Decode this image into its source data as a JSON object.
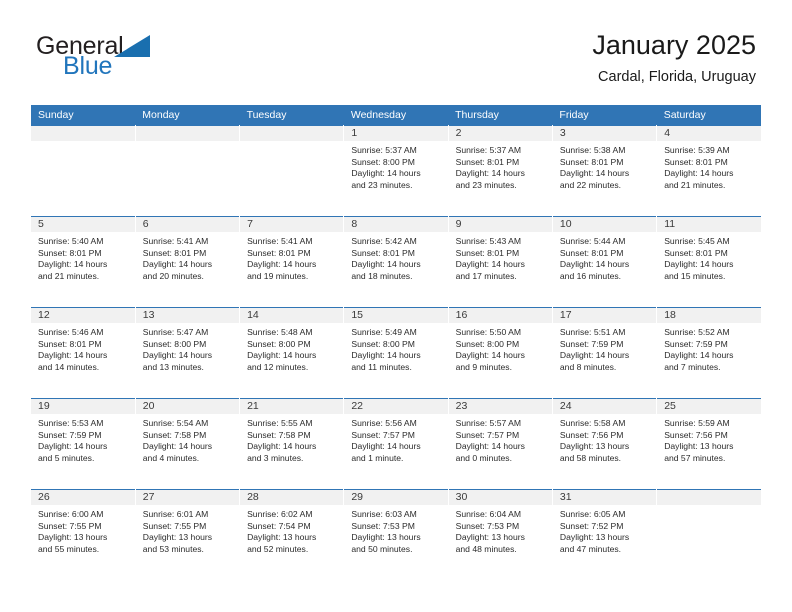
{
  "brand": {
    "name_part1": "General",
    "name_part2": "Blue",
    "triangle_icon": "blue-triangle-logo-mark",
    "accent_color": "#2175bc"
  },
  "header": {
    "title": "January 2025",
    "subtitle": "Cardal, Florida, Uruguay"
  },
  "colors": {
    "header_row_background": "#3075b5",
    "header_row_text": "#ffffff",
    "daynumber_band_background": "#f1f1f1",
    "cell_border": "#3075b5",
    "body_text": "#2b2b2b"
  },
  "weekdays": [
    "Sunday",
    "Monday",
    "Tuesday",
    "Wednesday",
    "Thursday",
    "Friday",
    "Saturday"
  ],
  "labels": {
    "sunrise_prefix": "Sunrise:",
    "sunset_prefix": "Sunset:",
    "daylight_prefix": "Daylight:"
  },
  "weeks": [
    [
      {
        "blank": true,
        "day": ""
      },
      {
        "blank": true,
        "day": ""
      },
      {
        "blank": true,
        "day": ""
      },
      {
        "day": "1",
        "sunrise": "Sunrise: 5:37 AM",
        "sunset": "Sunset: 8:00 PM",
        "daylight_line1": "Daylight: 14 hours",
        "daylight_line2": "and 23 minutes."
      },
      {
        "day": "2",
        "sunrise": "Sunrise: 5:37 AM",
        "sunset": "Sunset: 8:01 PM",
        "daylight_line1": "Daylight: 14 hours",
        "daylight_line2": "and 23 minutes."
      },
      {
        "day": "3",
        "sunrise": "Sunrise: 5:38 AM",
        "sunset": "Sunset: 8:01 PM",
        "daylight_line1": "Daylight: 14 hours",
        "daylight_line2": "and 22 minutes."
      },
      {
        "day": "4",
        "sunrise": "Sunrise: 5:39 AM",
        "sunset": "Sunset: 8:01 PM",
        "daylight_line1": "Daylight: 14 hours",
        "daylight_line2": "and 21 minutes."
      }
    ],
    [
      {
        "day": "5",
        "sunrise": "Sunrise: 5:40 AM",
        "sunset": "Sunset: 8:01 PM",
        "daylight_line1": "Daylight: 14 hours",
        "daylight_line2": "and 21 minutes."
      },
      {
        "day": "6",
        "sunrise": "Sunrise: 5:41 AM",
        "sunset": "Sunset: 8:01 PM",
        "daylight_line1": "Daylight: 14 hours",
        "daylight_line2": "and 20 minutes."
      },
      {
        "day": "7",
        "sunrise": "Sunrise: 5:41 AM",
        "sunset": "Sunset: 8:01 PM",
        "daylight_line1": "Daylight: 14 hours",
        "daylight_line2": "and 19 minutes."
      },
      {
        "day": "8",
        "sunrise": "Sunrise: 5:42 AM",
        "sunset": "Sunset: 8:01 PM",
        "daylight_line1": "Daylight: 14 hours",
        "daylight_line2": "and 18 minutes."
      },
      {
        "day": "9",
        "sunrise": "Sunrise: 5:43 AM",
        "sunset": "Sunset: 8:01 PM",
        "daylight_line1": "Daylight: 14 hours",
        "daylight_line2": "and 17 minutes."
      },
      {
        "day": "10",
        "sunrise": "Sunrise: 5:44 AM",
        "sunset": "Sunset: 8:01 PM",
        "daylight_line1": "Daylight: 14 hours",
        "daylight_line2": "and 16 minutes."
      },
      {
        "day": "11",
        "sunrise": "Sunrise: 5:45 AM",
        "sunset": "Sunset: 8:01 PM",
        "daylight_line1": "Daylight: 14 hours",
        "daylight_line2": "and 15 minutes."
      }
    ],
    [
      {
        "day": "12",
        "sunrise": "Sunrise: 5:46 AM",
        "sunset": "Sunset: 8:01 PM",
        "daylight_line1": "Daylight: 14 hours",
        "daylight_line2": "and 14 minutes."
      },
      {
        "day": "13",
        "sunrise": "Sunrise: 5:47 AM",
        "sunset": "Sunset: 8:00 PM",
        "daylight_line1": "Daylight: 14 hours",
        "daylight_line2": "and 13 minutes."
      },
      {
        "day": "14",
        "sunrise": "Sunrise: 5:48 AM",
        "sunset": "Sunset: 8:00 PM",
        "daylight_line1": "Daylight: 14 hours",
        "daylight_line2": "and 12 minutes."
      },
      {
        "day": "15",
        "sunrise": "Sunrise: 5:49 AM",
        "sunset": "Sunset: 8:00 PM",
        "daylight_line1": "Daylight: 14 hours",
        "daylight_line2": "and 11 minutes."
      },
      {
        "day": "16",
        "sunrise": "Sunrise: 5:50 AM",
        "sunset": "Sunset: 8:00 PM",
        "daylight_line1": "Daylight: 14 hours",
        "daylight_line2": "and 9 minutes."
      },
      {
        "day": "17",
        "sunrise": "Sunrise: 5:51 AM",
        "sunset": "Sunset: 7:59 PM",
        "daylight_line1": "Daylight: 14 hours",
        "daylight_line2": "and 8 minutes."
      },
      {
        "day": "18",
        "sunrise": "Sunrise: 5:52 AM",
        "sunset": "Sunset: 7:59 PM",
        "daylight_line1": "Daylight: 14 hours",
        "daylight_line2": "and 7 minutes."
      }
    ],
    [
      {
        "day": "19",
        "sunrise": "Sunrise: 5:53 AM",
        "sunset": "Sunset: 7:59 PM",
        "daylight_line1": "Daylight: 14 hours",
        "daylight_line2": "and 5 minutes."
      },
      {
        "day": "20",
        "sunrise": "Sunrise: 5:54 AM",
        "sunset": "Sunset: 7:58 PM",
        "daylight_line1": "Daylight: 14 hours",
        "daylight_line2": "and 4 minutes."
      },
      {
        "day": "21",
        "sunrise": "Sunrise: 5:55 AM",
        "sunset": "Sunset: 7:58 PM",
        "daylight_line1": "Daylight: 14 hours",
        "daylight_line2": "and 3 minutes."
      },
      {
        "day": "22",
        "sunrise": "Sunrise: 5:56 AM",
        "sunset": "Sunset: 7:57 PM",
        "daylight_line1": "Daylight: 14 hours",
        "daylight_line2": "and 1 minute."
      },
      {
        "day": "23",
        "sunrise": "Sunrise: 5:57 AM",
        "sunset": "Sunset: 7:57 PM",
        "daylight_line1": "Daylight: 14 hours",
        "daylight_line2": "and 0 minutes."
      },
      {
        "day": "24",
        "sunrise": "Sunrise: 5:58 AM",
        "sunset": "Sunset: 7:56 PM",
        "daylight_line1": "Daylight: 13 hours",
        "daylight_line2": "and 58 minutes."
      },
      {
        "day": "25",
        "sunrise": "Sunrise: 5:59 AM",
        "sunset": "Sunset: 7:56 PM",
        "daylight_line1": "Daylight: 13 hours",
        "daylight_line2": "and 57 minutes."
      }
    ],
    [
      {
        "day": "26",
        "sunrise": "Sunrise: 6:00 AM",
        "sunset": "Sunset: 7:55 PM",
        "daylight_line1": "Daylight: 13 hours",
        "daylight_line2": "and 55 minutes."
      },
      {
        "day": "27",
        "sunrise": "Sunrise: 6:01 AM",
        "sunset": "Sunset: 7:55 PM",
        "daylight_line1": "Daylight: 13 hours",
        "daylight_line2": "and 53 minutes."
      },
      {
        "day": "28",
        "sunrise": "Sunrise: 6:02 AM",
        "sunset": "Sunset: 7:54 PM",
        "daylight_line1": "Daylight: 13 hours",
        "daylight_line2": "and 52 minutes."
      },
      {
        "day": "29",
        "sunrise": "Sunrise: 6:03 AM",
        "sunset": "Sunset: 7:53 PM",
        "daylight_line1": "Daylight: 13 hours",
        "daylight_line2": "and 50 minutes."
      },
      {
        "day": "30",
        "sunrise": "Sunrise: 6:04 AM",
        "sunset": "Sunset: 7:53 PM",
        "daylight_line1": "Daylight: 13 hours",
        "daylight_line2": "and 48 minutes."
      },
      {
        "day": "31",
        "sunrise": "Sunrise: 6:05 AM",
        "sunset": "Sunset: 7:52 PM",
        "daylight_line1": "Daylight: 13 hours",
        "daylight_line2": "and 47 minutes."
      },
      {
        "blank": true,
        "day": ""
      }
    ]
  ]
}
